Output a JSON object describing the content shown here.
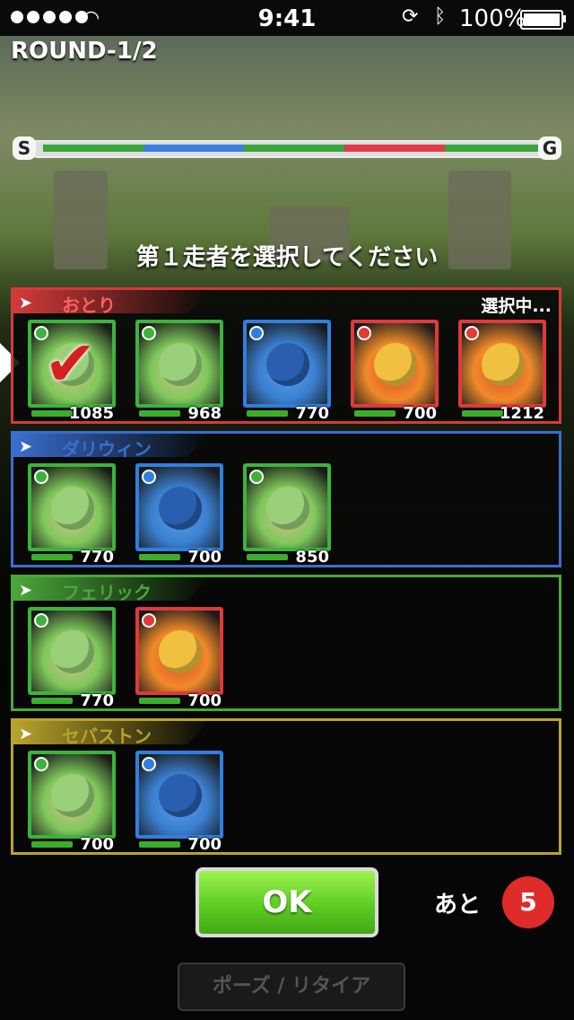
{
  "status_bar": {
    "time": "9:41",
    "battery": "100%",
    "bluetooth_icon": "bluetooth-icon",
    "rotation_lock_icon": "rotation-lock-icon",
    "wifi_icon": "wifi-icon"
  },
  "round_label": "ROUND-1/2",
  "track": {
    "start_label": "S",
    "goal_label": "G",
    "segment_colors": [
      "#3aa53a",
      "#3a7de0",
      "#3aa53a",
      "#e03a4a",
      "#3aa53a"
    ]
  },
  "prompt": "第１走者を選択してください",
  "teams": [
    {
      "name": "おとり",
      "color": "#d43a3a",
      "status": "選択中...",
      "monsters": [
        {
          "hp": "1085",
          "element": "wood",
          "selected": true
        },
        {
          "hp": "968",
          "element": "wood"
        },
        {
          "hp": "770",
          "element": "water"
        },
        {
          "hp": "700",
          "element": "fire"
        },
        {
          "hp": "1212",
          "element": "fire"
        }
      ]
    },
    {
      "name": "ダリウィン",
      "color": "#3a6ed0",
      "monsters": [
        {
          "hp": "770",
          "element": "wood"
        },
        {
          "hp": "700",
          "element": "water"
        },
        {
          "hp": "850",
          "element": "wood"
        }
      ]
    },
    {
      "name": "フェリック",
      "color": "#4aa83a",
      "monsters": [
        {
          "hp": "770",
          "element": "wood"
        },
        {
          "hp": "700",
          "element": "fire"
        }
      ]
    },
    {
      "name": "セバストン",
      "color": "#b8a42a",
      "monsters": [
        {
          "hp": "700",
          "element": "wood"
        },
        {
          "hp": "700",
          "element": "water"
        }
      ]
    }
  ],
  "ok_button": "OK",
  "remaining_label": "あと",
  "remaining_count": "5",
  "pause_button": "ポーズ / リタイア"
}
